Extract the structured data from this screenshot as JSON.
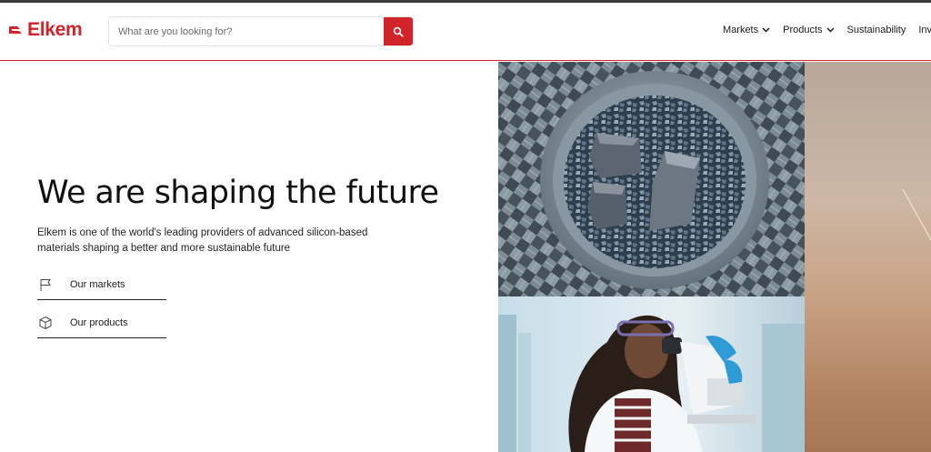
{
  "brand": {
    "name": "Elkem",
    "color": "#d2232a"
  },
  "search": {
    "placeholder": "What are you looking for?",
    "icon": "search-icon"
  },
  "nav": {
    "items": [
      {
        "label": "Markets",
        "has_dropdown": true
      },
      {
        "label": "Products",
        "has_dropdown": true
      },
      {
        "label": "Sustainability",
        "has_dropdown": false
      },
      {
        "label": "Inv",
        "has_dropdown": false
      }
    ]
  },
  "hero": {
    "title": "We are shaping the future",
    "description": "Elkem is one of the world's leading providers of advanced silicon-based materials shaping a better and more sustainable future",
    "links": [
      {
        "label": "Our markets",
        "icon": "flag-icon"
      },
      {
        "label": "Our products",
        "icon": "cube-icon"
      }
    ]
  }
}
